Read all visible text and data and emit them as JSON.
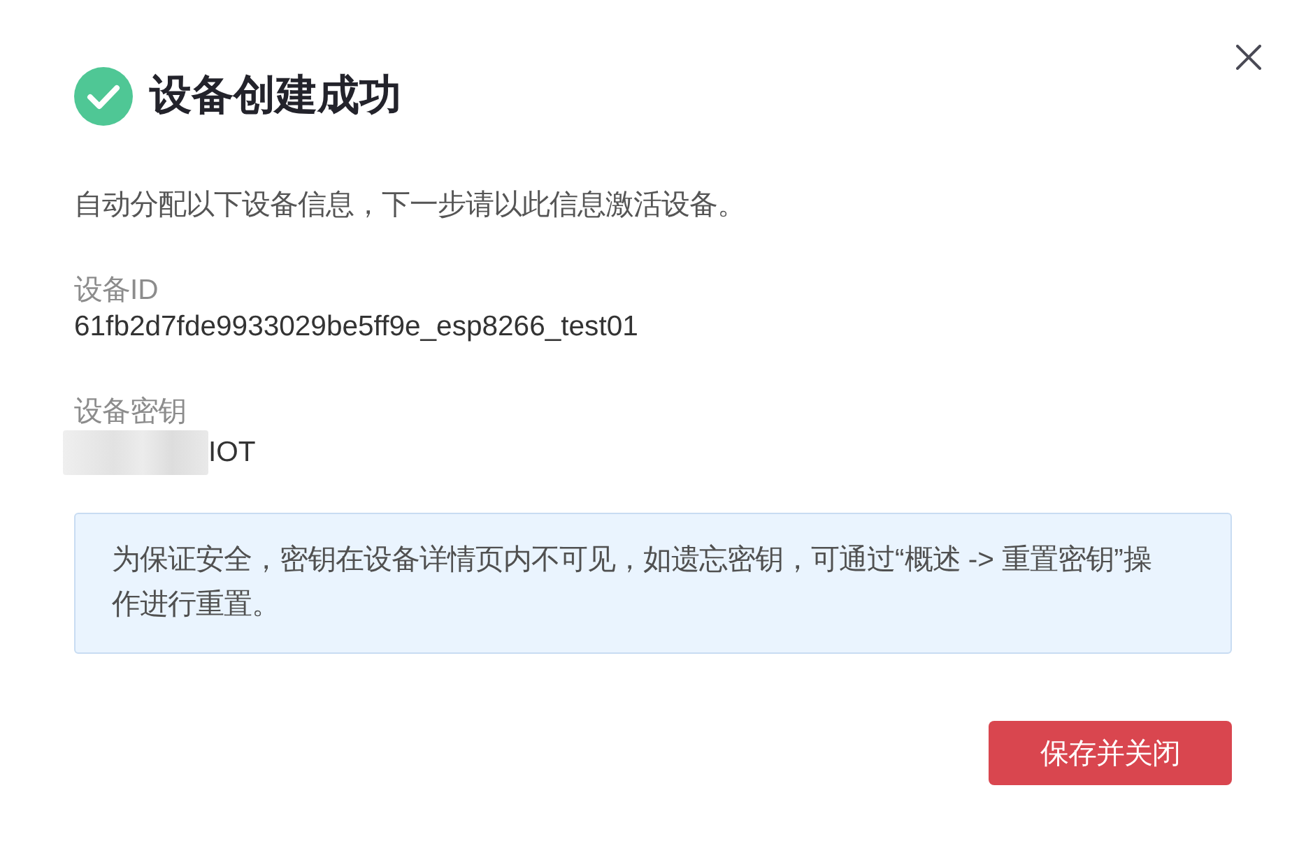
{
  "header": {
    "kind": "success",
    "title": "设备创建成功"
  },
  "description": "自动分配以下设备信息，下一步请以此信息激活设备。",
  "fields": [
    {
      "label": "设备ID",
      "value": "61fb2d7fde9933029be5ff9e_esp8266_test01",
      "redacted": false
    },
    {
      "label": "设备密钥",
      "value": "IOT",
      "redacted": true
    }
  ],
  "notice": "为保证安全，密钥在设备详情页内不可见，如遗忘密钥，可通过“概述 -> 重置密钥”操作进行重置。",
  "buttons": [
    {
      "label": "保存并关闭",
      "kind": "primary"
    }
  ]
}
